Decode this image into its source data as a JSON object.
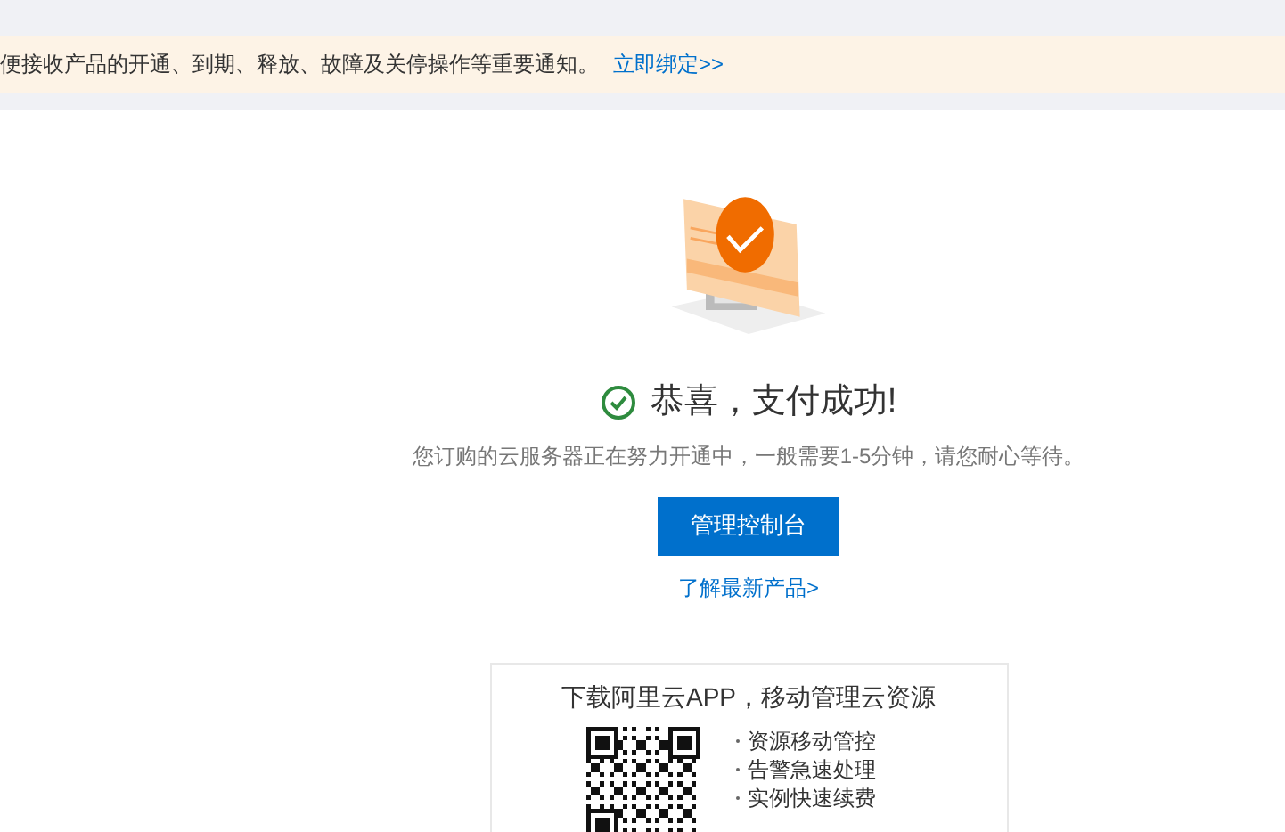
{
  "notice": {
    "text": "便接收产品的开通、到期、释放、故障及关停操作等重要通知。",
    "link": "立即绑定>>"
  },
  "result": {
    "title": "恭喜，支付成功!",
    "message": "您订购的云服务器正在努力开通中，一般需要1-5分钟，请您耐心等待。",
    "button": "管理控制台",
    "link": "了解最新产品>"
  },
  "app_card": {
    "title": "下载阿里云APP，移动管理云资源",
    "features": [
      "资源移动管控",
      "告警急速处理",
      "实例快速续费"
    ]
  }
}
